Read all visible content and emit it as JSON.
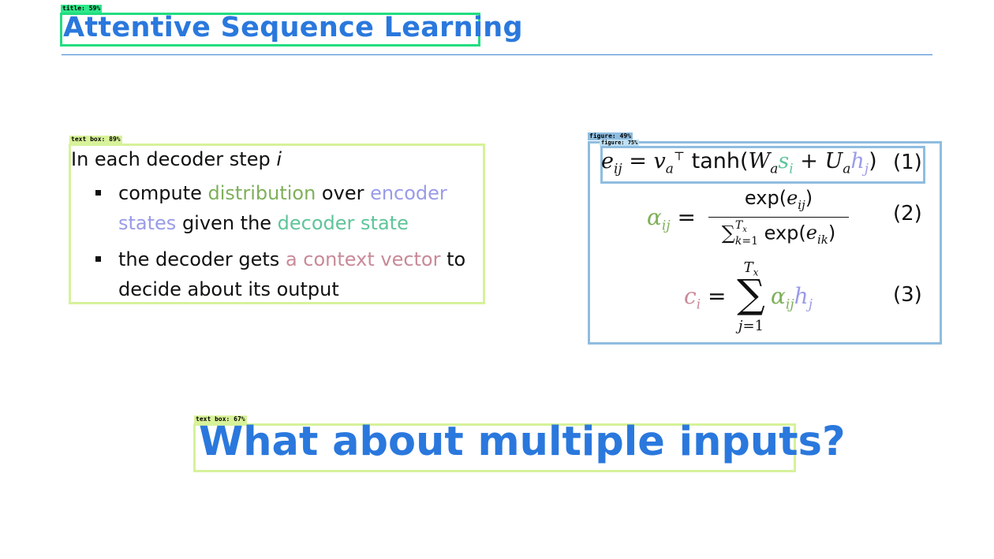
{
  "detections": {
    "title": "title: 59%",
    "text_box_1": "text box: 89%",
    "figure": "figure: 49%",
    "figure_inner": "figure: 75%",
    "text_box_2": "text box: 67%"
  },
  "slide": {
    "title": "Attentive Sequence Learning",
    "intro_text": "In each decoder step ",
    "intro_var": "i",
    "bullets": [
      {
        "parts": [
          "compute ",
          "distribution",
          " over ",
          "encoder states",
          " given the ",
          "decoder state"
        ]
      },
      {
        "parts": [
          "the decoder gets ",
          "a context vector",
          " to decide about its output"
        ]
      }
    ],
    "question": "What about multiple inputs?"
  },
  "equations": {
    "numbers": [
      "(1)",
      "(2)",
      "(3)"
    ]
  },
  "colors": {
    "title_blue": "#2a78dd",
    "green": "#7fb05a",
    "violet": "#9a9be8",
    "teal": "#5fc59a",
    "rose": "#c98a98",
    "title_box": "#22dd80",
    "text_box": "#d6f29a",
    "figure_box": "#8fbde0"
  }
}
